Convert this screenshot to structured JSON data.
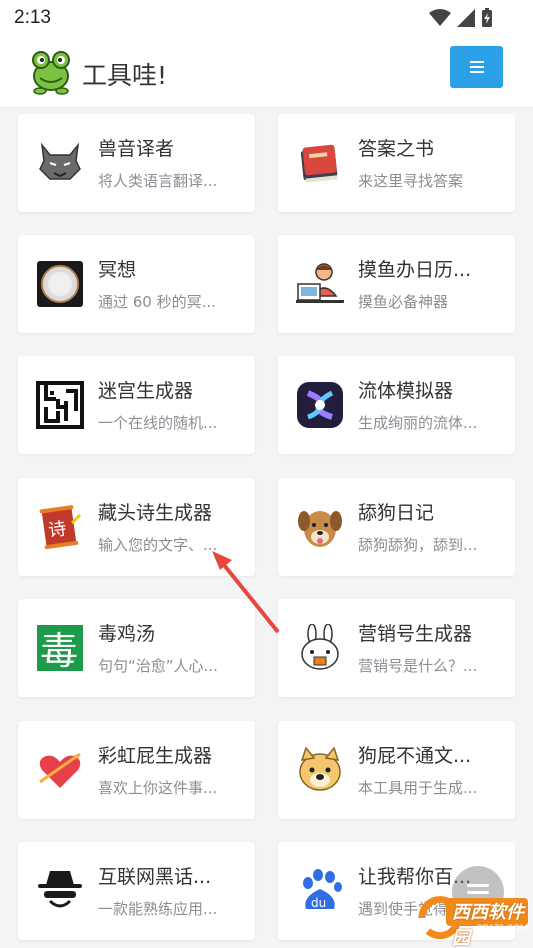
{
  "status_bar": {
    "time": "2:13"
  },
  "header": {
    "title": "工具哇!"
  },
  "cards": [
    {
      "title": "兽音译者",
      "desc": "将人类语言翻译..."
    },
    {
      "title": "答案之书",
      "desc": "来这里寻找答案"
    },
    {
      "title": "冥想",
      "desc": "通过 60 秒的冥..."
    },
    {
      "title": "摸鱼办日历...",
      "desc": "摸鱼必备神器"
    },
    {
      "title": "迷宫生成器",
      "desc": "一个在线的随机..."
    },
    {
      "title": "流体模拟器",
      "desc": "生成绚丽的流体..."
    },
    {
      "title": "藏头诗生成器",
      "desc": "输入您的文字、..."
    },
    {
      "title": "舔狗日记",
      "desc": "舔狗舔狗，舔到..."
    },
    {
      "title": "毒鸡汤",
      "desc": "句句“治愈”人心..."
    },
    {
      "title": "营销号生成器",
      "desc": "营销号是什么？..."
    },
    {
      "title": "彩虹屁生成器",
      "desc": "喜欢上你这件事..."
    },
    {
      "title": "狗屁不通文...",
      "desc": "本工具用于生成..."
    },
    {
      "title": "互联网黑话...",
      "desc": "一款能熟练应用..."
    },
    {
      "title": "让我帮你百...",
      "desc": "遇到使手觉得..."
    }
  ],
  "icons": {
    "poison_char": "毒",
    "poem_char": "诗",
    "baidu_text": "du"
  },
  "watermark": {
    "text": "西西软件园",
    "url": "CR173.COM"
  },
  "colors": {
    "accent": "#2ba0e6",
    "poison_green": "#1e9b4a",
    "poem_red": "#c0392b"
  }
}
